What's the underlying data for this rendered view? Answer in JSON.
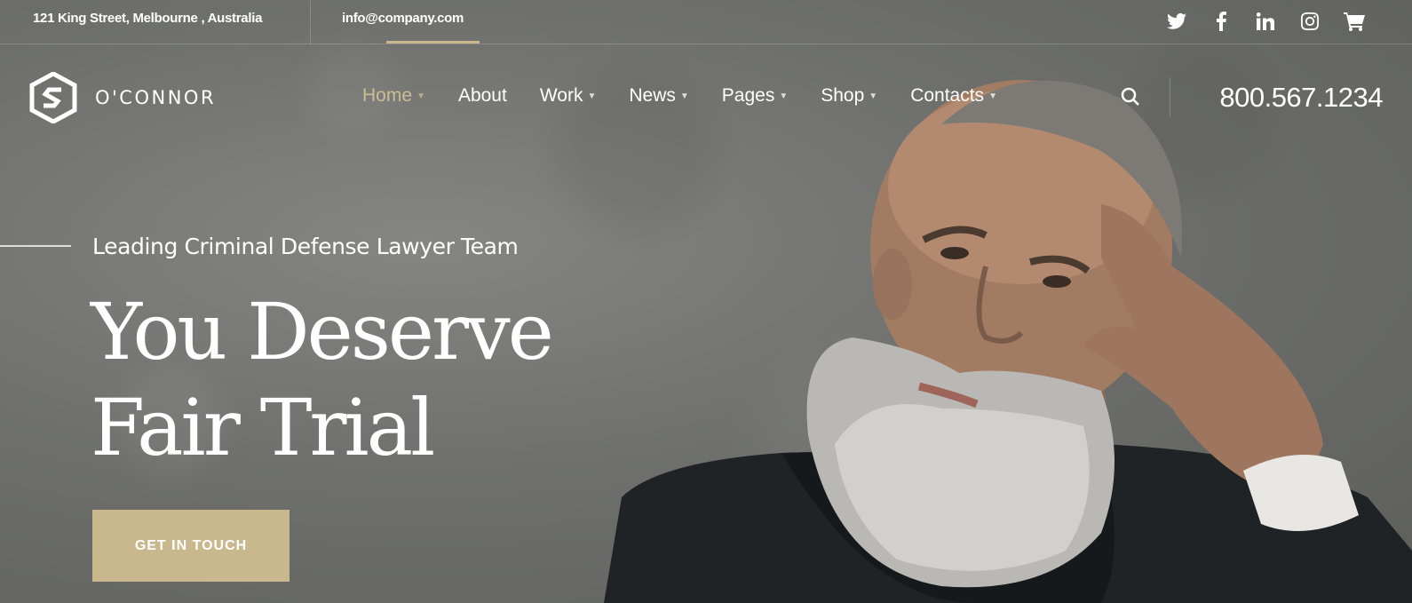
{
  "topbar": {
    "address": "121 King Street, Melbourne , Australia",
    "email": "info@company.com",
    "social_icons": [
      "twitter-icon",
      "facebook-icon",
      "linkedin-icon",
      "instagram-icon",
      "cart-icon"
    ]
  },
  "brand": {
    "name": "O'CONNOR"
  },
  "nav": {
    "items": [
      {
        "label": "Home",
        "has_dropdown": true,
        "active": true
      },
      {
        "label": "About",
        "has_dropdown": false,
        "active": false
      },
      {
        "label": "Work",
        "has_dropdown": true,
        "active": false
      },
      {
        "label": "News",
        "has_dropdown": true,
        "active": false
      },
      {
        "label": "Pages",
        "has_dropdown": true,
        "active": false
      },
      {
        "label": "Shop",
        "has_dropdown": true,
        "active": false
      },
      {
        "label": "Contacts",
        "has_dropdown": true,
        "active": false
      }
    ],
    "phone": "800.567.1234"
  },
  "hero": {
    "subtitle": "Leading Criminal Defense Lawyer Team",
    "headline_line1": "You Deserve",
    "headline_line2": "Fair Trial",
    "cta_label": "GET IN TOUCH"
  },
  "colors": {
    "accent": "#c9b88e",
    "active_nav": "#cdbd96",
    "text": "#ffffff",
    "background": "#6f706d"
  }
}
